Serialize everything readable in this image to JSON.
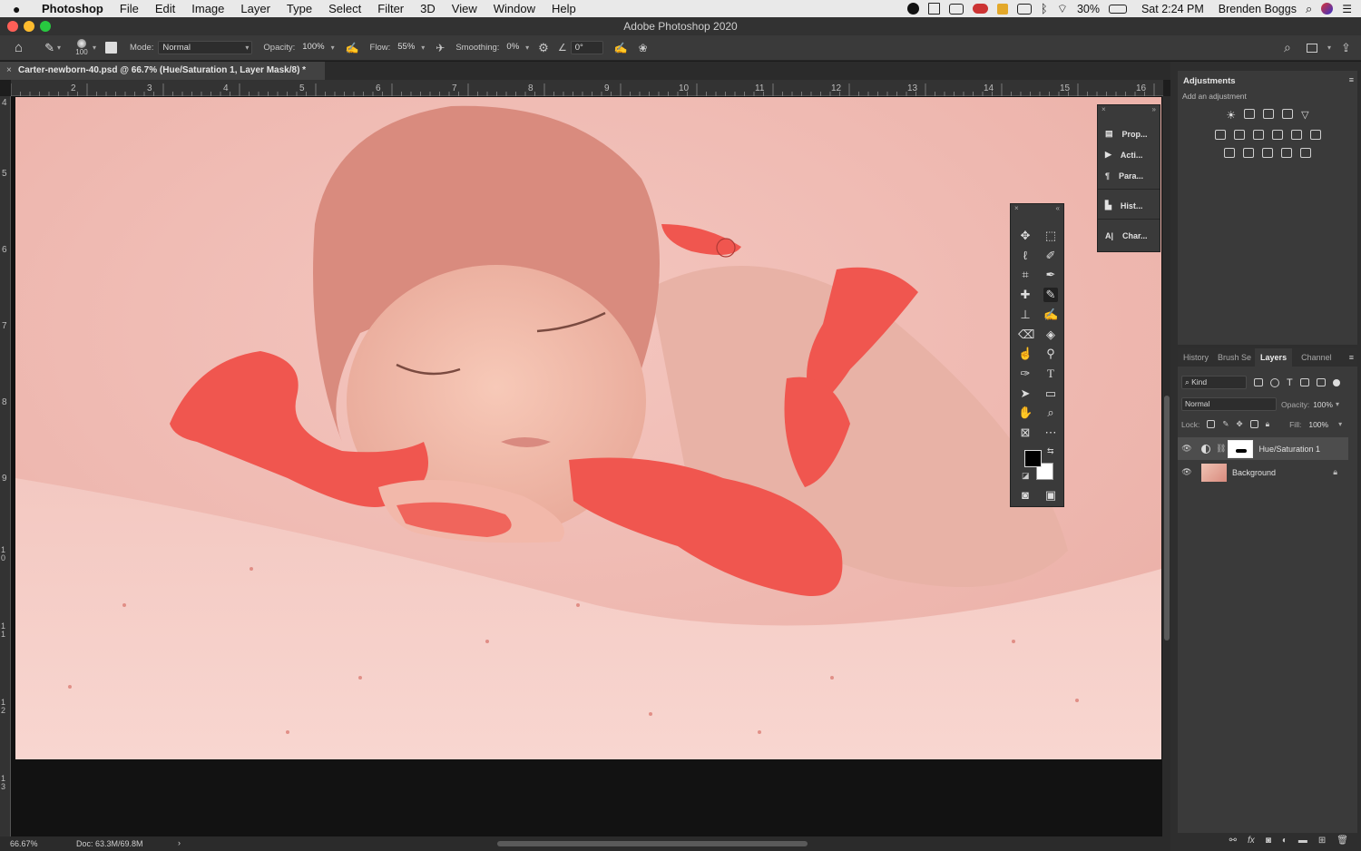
{
  "menubar": {
    "apple_icon": "apple-icon",
    "app_name": "Photoshop",
    "menus": [
      "File",
      "Edit",
      "Image",
      "Layer",
      "Type",
      "Select",
      "Filter",
      "3D",
      "View",
      "Window",
      "Help"
    ],
    "battery": "30%",
    "clock": "Sat 2:24 PM",
    "user": "Brenden Boggs"
  },
  "window": {
    "title": "Adobe Photoshop 2020"
  },
  "options": {
    "brush_size": "100",
    "mode_label": "Mode:",
    "mode_value": "Normal",
    "opacity_label": "Opacity:",
    "opacity_value": "100%",
    "flow_label": "Flow:",
    "flow_value": "55%",
    "smoothing_label": "Smoothing:",
    "smoothing_value": "0%",
    "angle_value": "0°"
  },
  "document": {
    "tab_title": "Carter-newborn-40.psd @ 66.7% (Hue/Saturation 1, Layer Mask/8) *",
    "zoom": "66.67%",
    "doc_size": "Doc: 63.3M/69.8M"
  },
  "ruler": {
    "h_labels": [
      "2",
      "3",
      "4",
      "5",
      "6",
      "7",
      "8",
      "9",
      "10",
      "11",
      "12",
      "13",
      "14",
      "15",
      "16"
    ],
    "v_labels": [
      "4",
      "5",
      "6",
      "7",
      "8",
      "9",
      "10",
      "11",
      "12",
      "13"
    ]
  },
  "float_panels": {
    "items": [
      {
        "icon": "properties-icon",
        "label": "Prop..."
      },
      {
        "icon": "actions-icon",
        "label": "Acti..."
      },
      {
        "icon": "paragraph-icon",
        "label": "Para..."
      },
      {
        "icon": "histogram-icon",
        "label": "Hist..."
      },
      {
        "icon": "character-icon",
        "label": "Char..."
      }
    ]
  },
  "adjustments": {
    "title": "Adjustments",
    "subtitle": "Add an adjustment"
  },
  "layers_panel": {
    "tabs": [
      "History",
      "Brush Se",
      "Layers",
      "Channel"
    ],
    "active_tab": "Layers",
    "filter_kind": "Kind",
    "blend_mode": "Normal",
    "opacity_label": "Opacity:",
    "opacity_value": "100%",
    "lock_label": "Lock:",
    "fill_label": "Fill:",
    "fill_value": "100%",
    "layers": [
      {
        "name": "Hue/Saturation 1",
        "selected": true
      },
      {
        "name": "Background",
        "selected": false
      }
    ]
  },
  "colors": {
    "accent_brush": "#ff5b5b",
    "panel_bg": "#3a3a3a",
    "canvas_bg": "#121212"
  }
}
